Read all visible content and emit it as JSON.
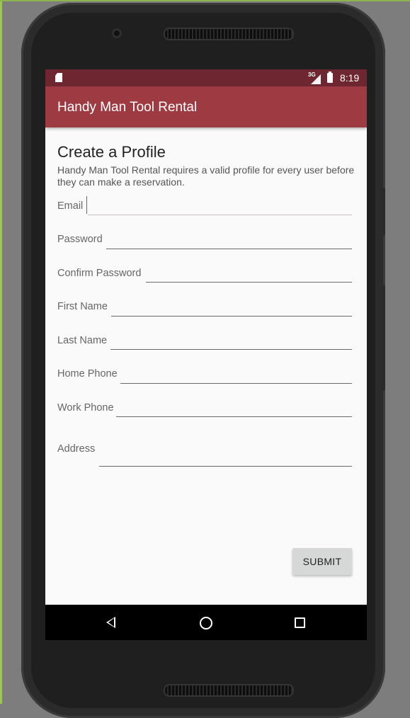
{
  "status_bar": {
    "network_type": "3G",
    "time": "8:19",
    "icons": [
      "sd-card-icon",
      "signal-icon",
      "battery-icon"
    ]
  },
  "app_bar": {
    "title": "Handy Man Tool Rental",
    "color": "#9d3a42",
    "status_color": "#6e2730"
  },
  "form": {
    "title": "Create a Profile",
    "description": "Handy Man Tool Rental requires a valid profile for every user before they can make a reservation.",
    "fields": {
      "email": {
        "label": "Email",
        "value": ""
      },
      "password": {
        "label": "Password",
        "value": ""
      },
      "confirm_password": {
        "label": "Confirm Password",
        "value": ""
      },
      "first_name": {
        "label": "First Name",
        "value": ""
      },
      "last_name": {
        "label": "Last Name",
        "value": ""
      },
      "home_phone": {
        "label": "Home Phone",
        "value": ""
      },
      "work_phone": {
        "label": "Work Phone",
        "value": ""
      },
      "address": {
        "label": "Address",
        "value": ""
      }
    },
    "submit_label": "SUBMIT"
  },
  "nav_bar": {
    "icons": [
      "back-icon",
      "home-icon",
      "recent-apps-icon"
    ]
  }
}
